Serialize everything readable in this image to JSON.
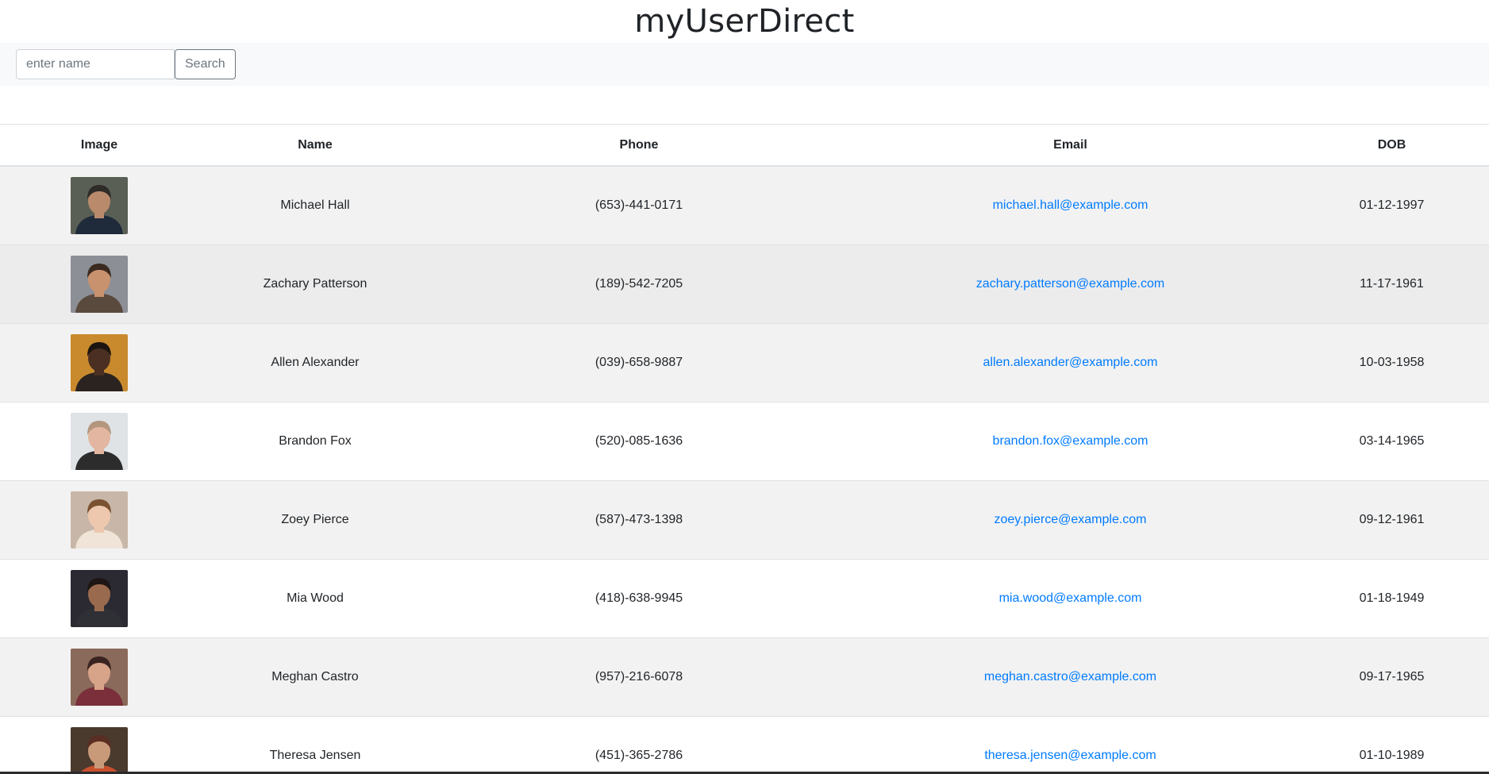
{
  "app": {
    "title": "myUserDirect"
  },
  "search": {
    "placeholder": "enter name",
    "value": "",
    "button_label": "Search"
  },
  "table": {
    "columns": [
      "Image",
      "Name",
      "Phone",
      "Email",
      "DOB"
    ],
    "rows": [
      {
        "name": "Michael Hall",
        "phone": "(653)-441-0171",
        "email": "michael.hall@example.com",
        "dob": "01-12-1997",
        "avatar": {
          "bg": "#5a5f55",
          "skin": "#b98a6c",
          "hair": "#2e2b28",
          "shirt": "#1f2a3a"
        }
      },
      {
        "name": "Zachary Patterson",
        "phone": "(189)-542-7205",
        "email": "zachary.patterson@example.com",
        "dob": "11-17-1961",
        "avatar": {
          "bg": "#8c8f96",
          "skin": "#c9926e",
          "hair": "#3b2a20",
          "shirt": "#5a4a3e"
        }
      },
      {
        "name": "Allen Alexander",
        "phone": "(039)-658-9887",
        "email": "allen.alexander@example.com",
        "dob": "10-03-1958",
        "avatar": {
          "bg": "#c98a2e",
          "skin": "#4a2f22",
          "hair": "#1c1410",
          "shirt": "#2a2320"
        }
      },
      {
        "name": "Brandon Fox",
        "phone": "(520)-085-1636",
        "email": "brandon.fox@example.com",
        "dob": "03-14-1965",
        "avatar": {
          "bg": "#dfe3e6",
          "skin": "#e2b6a0",
          "hair": "#b4967e",
          "shirt": "#2c2c2c"
        }
      },
      {
        "name": "Zoey Pierce",
        "phone": "(587)-473-1398",
        "email": "zoey.pierce@example.com",
        "dob": "09-12-1961",
        "avatar": {
          "bg": "#c8b7a8",
          "skin": "#edc7ae",
          "hair": "#7a5232",
          "shirt": "#f0e4d8"
        }
      },
      {
        "name": "Mia Wood",
        "phone": "(418)-638-9945",
        "email": "mia.wood@example.com",
        "dob": "01-18-1949",
        "avatar": {
          "bg": "#2b2a33",
          "skin": "#9a6a4e",
          "hair": "#1d1614",
          "shirt": "#2f2f36"
        }
      },
      {
        "name": "Meghan Castro",
        "phone": "(957)-216-6078",
        "email": "meghan.castro@example.com",
        "dob": "09-17-1965",
        "avatar": {
          "bg": "#8a6a5a",
          "skin": "#d7a489",
          "hair": "#3a2420",
          "shirt": "#7a2f3a"
        }
      },
      {
        "name": "Theresa Jensen",
        "phone": "(451)-365-2786",
        "email": "theresa.jensen@example.com",
        "dob": "01-10-1989",
        "avatar": {
          "bg": "#4a3a2e",
          "skin": "#c89a7a",
          "hair": "#5a2e22",
          "shirt": "#c8502e"
        }
      }
    ]
  },
  "colors": {
    "link": "#007bff",
    "stripe": "#f2f2f2",
    "hover_row": "#ececec",
    "toolbar_bg": "#f8f9fa"
  }
}
